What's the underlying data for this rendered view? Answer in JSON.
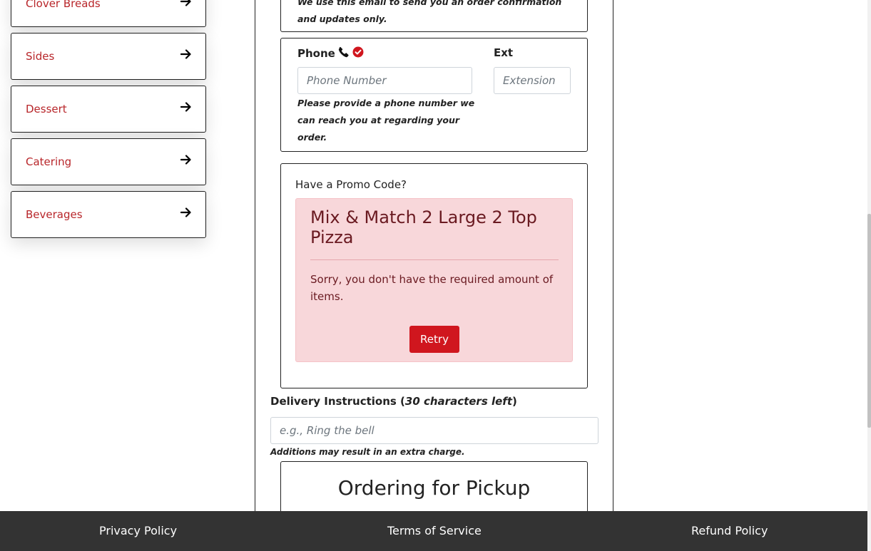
{
  "sidebar": {
    "items": [
      {
        "label": "Clover Breads"
      },
      {
        "label": "Sides"
      },
      {
        "label": "Dessert"
      },
      {
        "label": "Catering"
      },
      {
        "label": "Beverages"
      }
    ]
  },
  "email": {
    "help": "We use this email to send you an order confirmation and updates only."
  },
  "phone": {
    "label": "Phone",
    "placeholder": "Phone Number",
    "help": "Please provide a phone number we can reach you at regarding your order.",
    "ext_label": "Ext",
    "ext_placeholder": "Extension"
  },
  "promo": {
    "title": "Have a Promo Code?",
    "alert_heading": "Mix & Match 2 Large 2 Top Pizza",
    "alert_message": "Sorry, you don't have the required amount of items.",
    "retry_label": "Retry"
  },
  "delivery_instructions": {
    "label": "Delivery Instructions (",
    "count": "30 characters left",
    "label_end": ")",
    "placeholder": "e.g., Ring the bell",
    "help": "Additions may result in an extra charge."
  },
  "pickup": {
    "title": "Ordering for Pickup"
  },
  "footer": {
    "privacy": "Privacy Policy",
    "terms": "Terms of Service",
    "refund": "Refund Policy"
  },
  "colors": {
    "accent_red": "#d0161e",
    "category_text": "#b8262a",
    "alert_bg": "#f8d7da",
    "footer_bg": "#333333"
  }
}
